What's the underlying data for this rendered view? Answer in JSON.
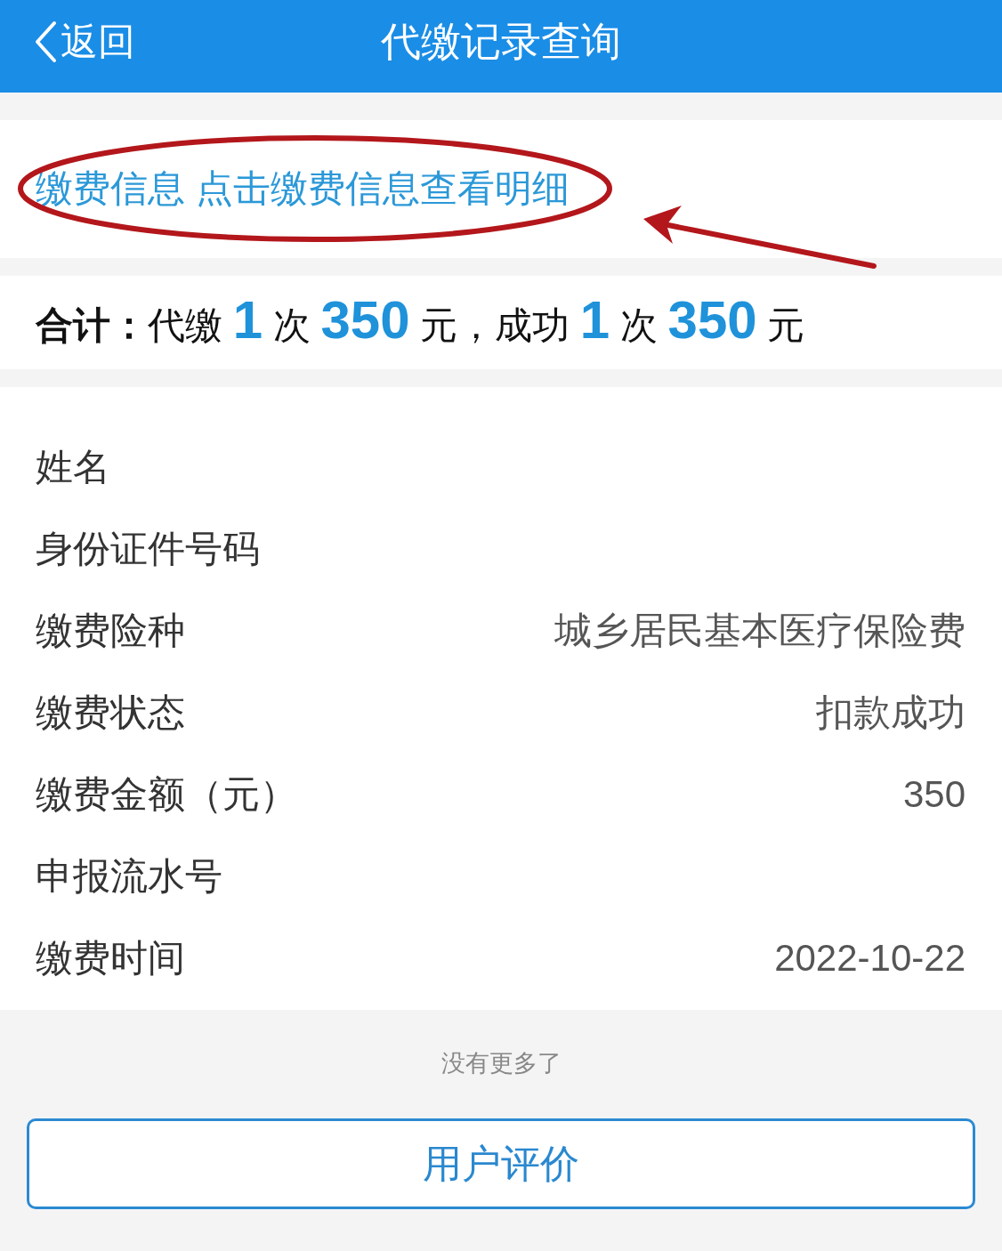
{
  "header": {
    "back": {
      "label": "返回"
    },
    "title": "代缴记录查询"
  },
  "info": {
    "text": "缴费信息 点击缴费信息查看明细",
    "highlighted": true
  },
  "summary": {
    "label": "合计：",
    "text": "代缴 **1** 次 **350** 元，成功 **1** 次 **350** 元"
  },
  "details": [
    {
      "label": "姓名"
    },
    {
      "label": "身份证件号码"
    },
    {
      "label": "缴费险种",
      "value": "城乡居民基本医疗保险费"
    },
    {
      "label": "缴费状态",
      "value": "扣款成功"
    },
    {
      "label": "缴费金额（元）",
      "value": "350"
    },
    {
      "label": "申报流水号"
    },
    {
      "label": "缴费时间",
      "value": "2022-10-22"
    }
  ],
  "end_note": "没有更多了",
  "rate_button": "用户评价"
}
